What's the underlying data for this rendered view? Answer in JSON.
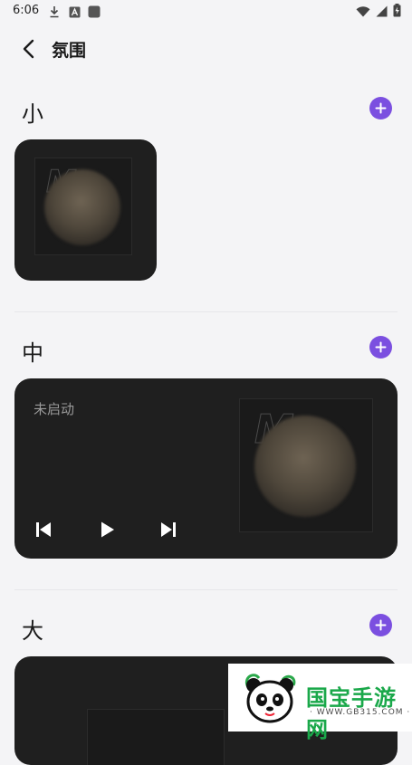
{
  "status_bar": {
    "time": "6:06",
    "icons_left": [
      "download-icon",
      "font-a-icon",
      "app-square-icon"
    ],
    "icons_right": [
      "wifi-icon",
      "signal-icon",
      "battery-charging-icon"
    ]
  },
  "header": {
    "title": "氛围",
    "back_icon": "chevron-left-icon"
  },
  "sections": {
    "small": {
      "label": "小",
      "add_icon": "plus-icon"
    },
    "medium": {
      "label": "中",
      "add_icon": "plus-icon",
      "status": "未启动",
      "controls": [
        "skip-previous-icon",
        "play-icon",
        "skip-next-icon"
      ]
    },
    "large": {
      "label": "大",
      "add_icon": "plus-icon"
    }
  },
  "album_art": {
    "letter": "M"
  },
  "colors": {
    "accent": "#7b4fe0",
    "card_bg": "#1f1f1f",
    "page_bg": "#f4f4f6"
  },
  "watermark": {
    "name": "国宝手游网",
    "url": "· WWW.GB315.COM ·"
  }
}
